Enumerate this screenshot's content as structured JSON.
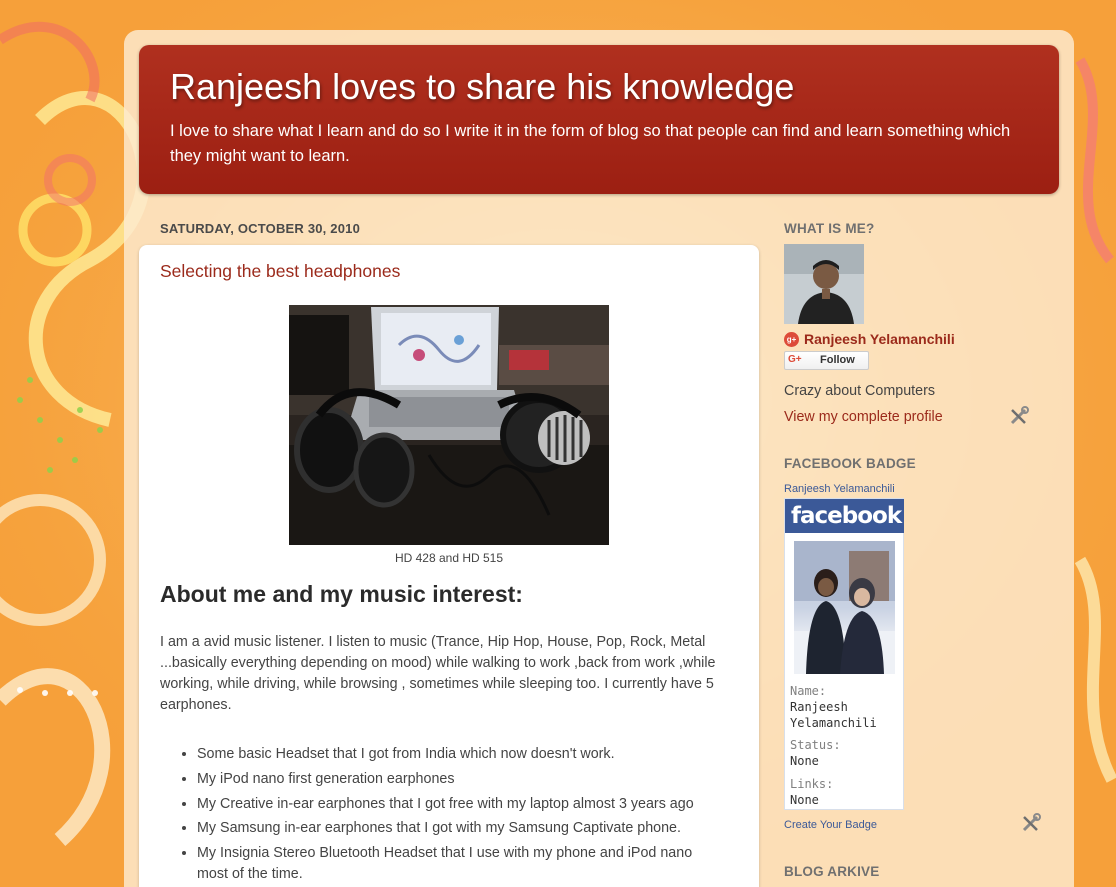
{
  "header": {
    "title": "Ranjeesh loves to share his knowledge",
    "description": "I love to share what I learn and do so I write it in the form of blog so that people can find and learn something which they might want to learn."
  },
  "post": {
    "date": "SATURDAY, OCTOBER 30, 2010",
    "title": "Selecting the best headphones",
    "image_caption": "HD 428 and HD 515",
    "section_heading": "About me and my music interest:",
    "paragraph": "I am a avid music listener. I listen to music (Trance, Hip Hop, House, Pop, Rock, Metal ...basically everything depending on mood) while walking to work ,back from work ,while working, while driving, while browsing , sometimes while sleeping too. I currently have 5 earphones.",
    "bullets": [
      "Some basic Headset that I got from India which now doesn't work.",
      "My iPod nano first generation earphones",
      "My Creative in-ear earphones that I got free with my laptop almost 3 years ago",
      "My Samsung in-ear earphones that I got with my Samsung Captivate phone.",
      "My Insignia Stereo Bluetooth Headset that I use with my phone and iPod nano most of the time."
    ]
  },
  "sidebar": {
    "profile_widget_title": "WHAT IS ME?",
    "gplus_glyph": "g+",
    "profile_name": "Ranjeesh Yelamanchili",
    "follow_glyph": "G+",
    "follow_label": "Follow",
    "about": "Crazy about Computers",
    "profile_link": "View my complete profile",
    "facebook_widget_title": "FACEBOOK BADGE",
    "facebook_name_link": "Ranjeesh Yelamanchili",
    "facebook_logo_text": "facebook",
    "fb_fields": {
      "name_label": "Name:",
      "name_value_1": "Ranjeesh",
      "name_value_2": "Yelamanchili",
      "status_label": "Status:",
      "status_value": "None",
      "links_label": "Links:",
      "links_value": "None"
    },
    "create_badge_link": "Create Your Badge",
    "archive_widget_title": "BLOG ARKIVE"
  },
  "icons": {
    "edit_tool": "wrench-screwdriver-icon",
    "gplus": "google-plus-icon"
  },
  "colors": {
    "background": "#f7a23a",
    "header": "#a8281a",
    "accent_link": "#9b2a1b",
    "facebook": "#3b5998"
  }
}
